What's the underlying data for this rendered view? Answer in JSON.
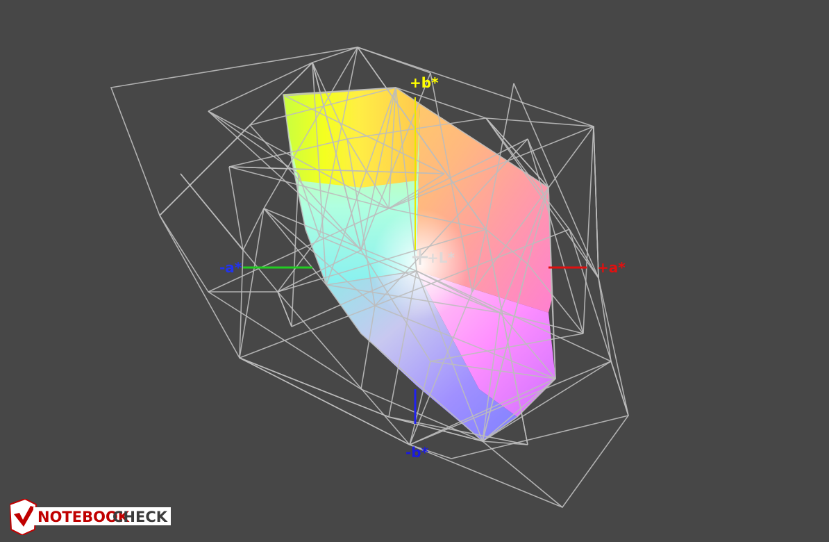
{
  "axes": {
    "plus_b": {
      "text": "+b*",
      "color": "#ffff00"
    },
    "minus_b": {
      "text": "-b*",
      "color": "#1a1adf"
    },
    "plus_a": {
      "text": "+a*",
      "color": "#e01010"
    },
    "minus_a": {
      "text": "-a*",
      "color": "#2233ee"
    },
    "plus_l": {
      "text": "+L*",
      "color": "#d8d8d8"
    }
  },
  "colors": {
    "background": "#474747",
    "wireframe": "#bdbdbd",
    "green_axis": "#22cc22"
  },
  "watermark": {
    "brand_red": "NOTEBOOK",
    "brand_white": "CHECK",
    "logo_icon": "notebookcheck-checkmark-logo"
  }
}
